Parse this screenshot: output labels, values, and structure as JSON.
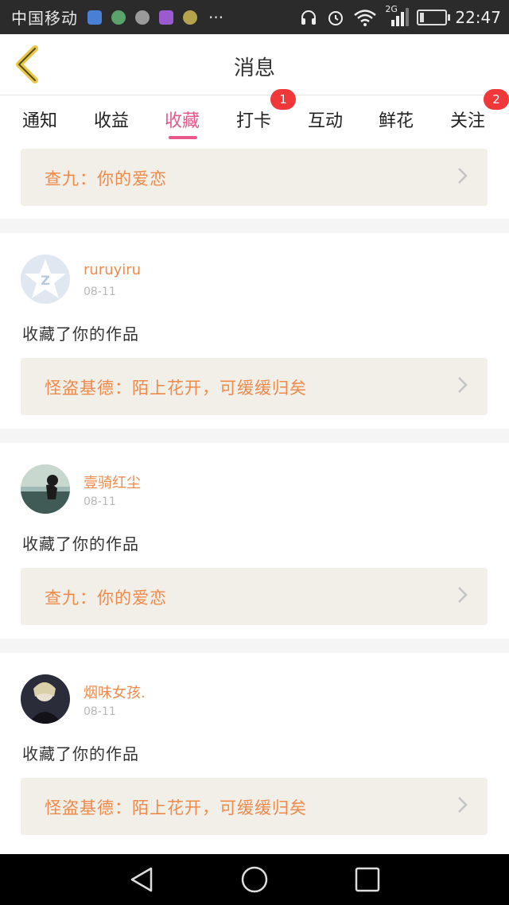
{
  "status_bar": {
    "carrier": "中国移动",
    "network": "2G",
    "time": "22:47",
    "battery_level_percent": 15,
    "icons": [
      "notification-icon-1",
      "notification-icon-2",
      "notification-icon-3",
      "notification-icon-4",
      "notification-icon-5"
    ],
    "more": "···"
  },
  "header": {
    "title": "消息",
    "back_icon": "chevron-left-icon"
  },
  "tabs": [
    {
      "label": "通知",
      "active": false
    },
    {
      "label": "收益",
      "active": false
    },
    {
      "label": "收藏",
      "active": true
    },
    {
      "label": "打卡",
      "active": false,
      "badge": "1"
    },
    {
      "label": "互动",
      "active": false
    },
    {
      "label": "鲜花",
      "active": false
    },
    {
      "label": "关注",
      "active": false,
      "badge": "2"
    }
  ],
  "colors": {
    "accent": "#e8578a",
    "name_orange": "#f08a4b",
    "badge_red": "#f0383a",
    "ref_bg": "#f1efe8"
  },
  "items": [
    {
      "ref_text": "查九：你的爱恋"
    },
    {
      "username": "ruruyiru",
      "date": "08-11",
      "action": "收藏了你的作品",
      "ref_text": "怪盗基德：陌上花开，可缓缓归矣",
      "avatar": "default-avatar-icon"
    },
    {
      "username": "壹骑红尘",
      "date": "08-11",
      "action": "收藏了你的作品",
      "ref_text": "查九：你的爱恋",
      "avatar": "user-photo-avatar"
    },
    {
      "username": "烟味女孩.",
      "date": "08-11",
      "action": "收藏了你的作品",
      "ref_text": "怪盗基德：陌上花开，可缓缓归矣",
      "avatar": "user-photo-avatar"
    }
  ],
  "nav_bar": {
    "back": "triangle-back-icon",
    "home": "circle-home-icon",
    "recents": "square-recents-icon"
  }
}
